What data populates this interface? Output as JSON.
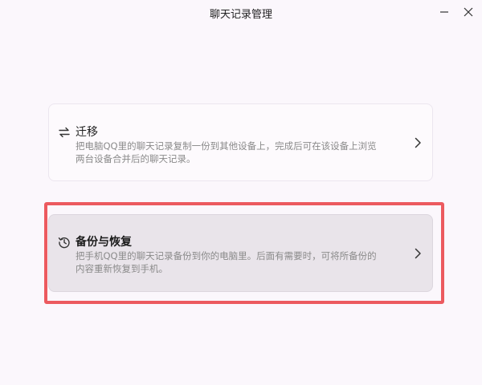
{
  "window": {
    "title": "聊天记录管理",
    "minimize_icon": "minimize-icon",
    "close_icon": "close-icon"
  },
  "options": [
    {
      "key": "migrate",
      "icon": "swap-arrows-icon",
      "title": "迁移",
      "description": "把电脑QQ里的聊天记录复制一份到其他设备上，完成后可在该设备上浏览两台设备合并后的聊天记录。",
      "chevron_icon": "chevron-right-icon",
      "highlighted": false
    },
    {
      "key": "backup",
      "icon": "history-restore-icon",
      "title": "备份与恢复",
      "description": "把手机QQ里的聊天记录备份到你的电脑里。后面有需要时，可将所备份的内容重新恢复到手机。",
      "chevron_icon": "chevron-right-icon",
      "highlighted": true
    }
  ],
  "colors": {
    "background": "#fbf7fc",
    "highlight_border": "#ec5a5f",
    "selected_card": "#e9e4ea",
    "description_text": "#8a8a8a"
  }
}
